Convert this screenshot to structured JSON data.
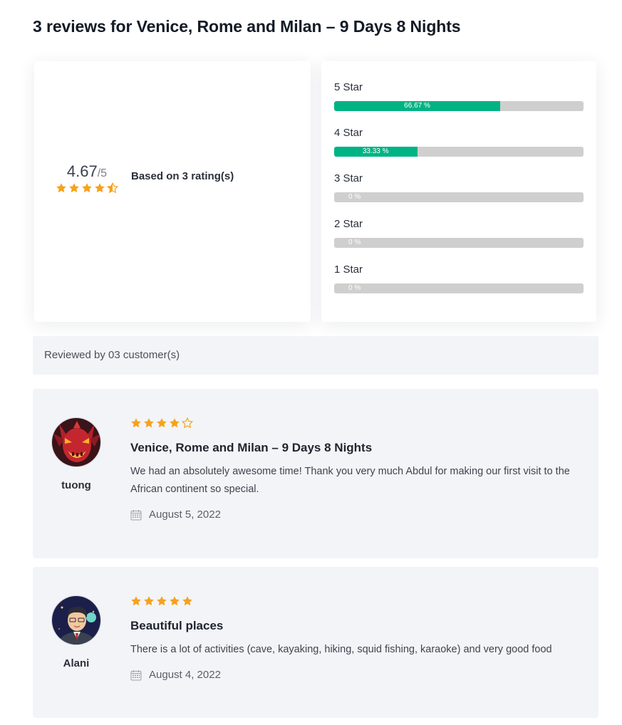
{
  "page": {
    "section_title": "3 reviews for Venice, Rome and Milan – 9 Days 8 Nights"
  },
  "summary": {
    "score": "4.67",
    "score_max": "/5",
    "average_rating": 4.67,
    "based_on": "Based on 3 rating(s)"
  },
  "breakdown": [
    {
      "label": "5 Star",
      "percent_text": "66.67 %",
      "fraction": 0.6667
    },
    {
      "label": "4 Star",
      "percent_text": "33.33 %",
      "fraction": 0.3333
    },
    {
      "label": "3 Star",
      "percent_text": "0 %",
      "fraction": 0
    },
    {
      "label": "2 Star",
      "percent_text": "0 %",
      "fraction": 0
    },
    {
      "label": "1 Star",
      "percent_text": "0 %",
      "fraction": 0
    }
  ],
  "reviewed_by": "Reviewed by 03 customer(s)",
  "reviews": [
    {
      "name": "tuong",
      "rating": 4,
      "title": "Venice, Rome and Milan – 9 Days 8 Nights",
      "body": "We had an absolutely awesome time! Thank you very much Abdul for making our first visit to the African continent so special.",
      "date": "August 5, 2022",
      "avatar_icon": "demon-avatar"
    },
    {
      "name": "Alani",
      "rating": 5,
      "title": "Beautiful places",
      "body": "There is a lot of activities (cave, kayaking, hiking, squid fishing, karaoke) and very good food",
      "date": "August 4, 2022",
      "avatar_icon": "man-avatar"
    }
  ],
  "colors": {
    "star": "#f7a21b",
    "bar_fill": "#00b383",
    "bar_track": "#cfcfcf",
    "card_bg": "#f3f4f7"
  }
}
